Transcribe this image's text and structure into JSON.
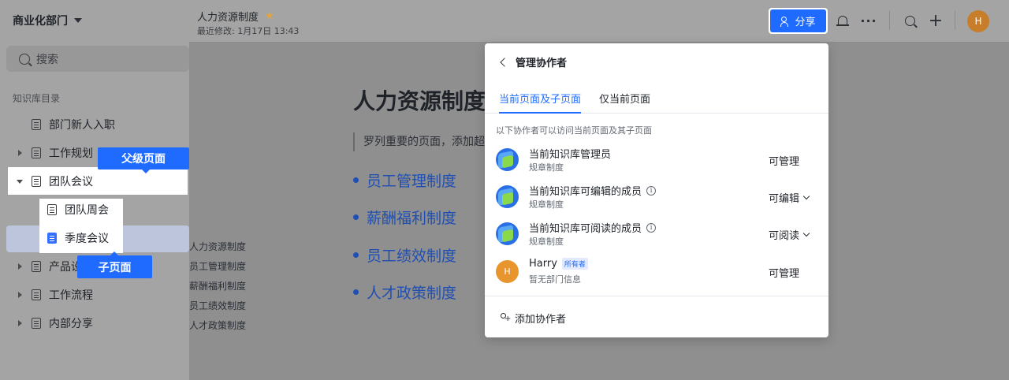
{
  "sidebar": {
    "space_title": "商业化部门",
    "search_placeholder": "搜索",
    "directory_label": "知识库目录",
    "items": [
      {
        "label": "部门新人入职"
      },
      {
        "label": "工作规划"
      },
      {
        "label": "团队会议"
      },
      {
        "label": "团队周会"
      },
      {
        "label": "季度会议"
      },
      {
        "label": "产品设"
      },
      {
        "label": "工作流程"
      },
      {
        "label": "内部分享"
      }
    ],
    "callouts": {
      "parent": "父级页面",
      "child": "子页面"
    }
  },
  "header": {
    "doc_title": "人力资源制度",
    "last_modified": "最近修改: 1月17日 13:43",
    "share_label": "分享",
    "more_label": "···",
    "avatar_initial": "H"
  },
  "main": {
    "heading": "人力资源制度",
    "quote": "罗列重要的页面，添加超",
    "bullets": [
      "员工管理制度",
      "薪酬福利制度",
      "员工绩效制度",
      "人才政策制度"
    ],
    "outline": [
      "人力资源制度",
      "员工管理制度",
      "薪酬福利制度",
      "员工绩效制度",
      "人才政策制度"
    ]
  },
  "popup": {
    "title": "管理协作者",
    "tabs": [
      "当前页面及子页面",
      "仅当前页面"
    ],
    "description": "以下协作者可以访问当前页面及其子页面",
    "members": [
      {
        "name": "当前知识库管理员",
        "sub": "规章制度",
        "permission": "可管理"
      },
      {
        "name": "当前知识库可编辑的成员",
        "sub": "规章制度",
        "permission": "可编辑"
      },
      {
        "name": "当前知识库可阅读的成员",
        "sub": "规章制度",
        "permission": "可阅读"
      },
      {
        "name": "Harry",
        "badge": "所有者",
        "sub": "暂无部门信息",
        "permission": "可管理",
        "initial": "H"
      }
    ],
    "add_label": "添加协作者"
  },
  "colors": {
    "accent": "#1f6bff",
    "avatar": "#e8952d",
    "star": "#e5a53a"
  }
}
